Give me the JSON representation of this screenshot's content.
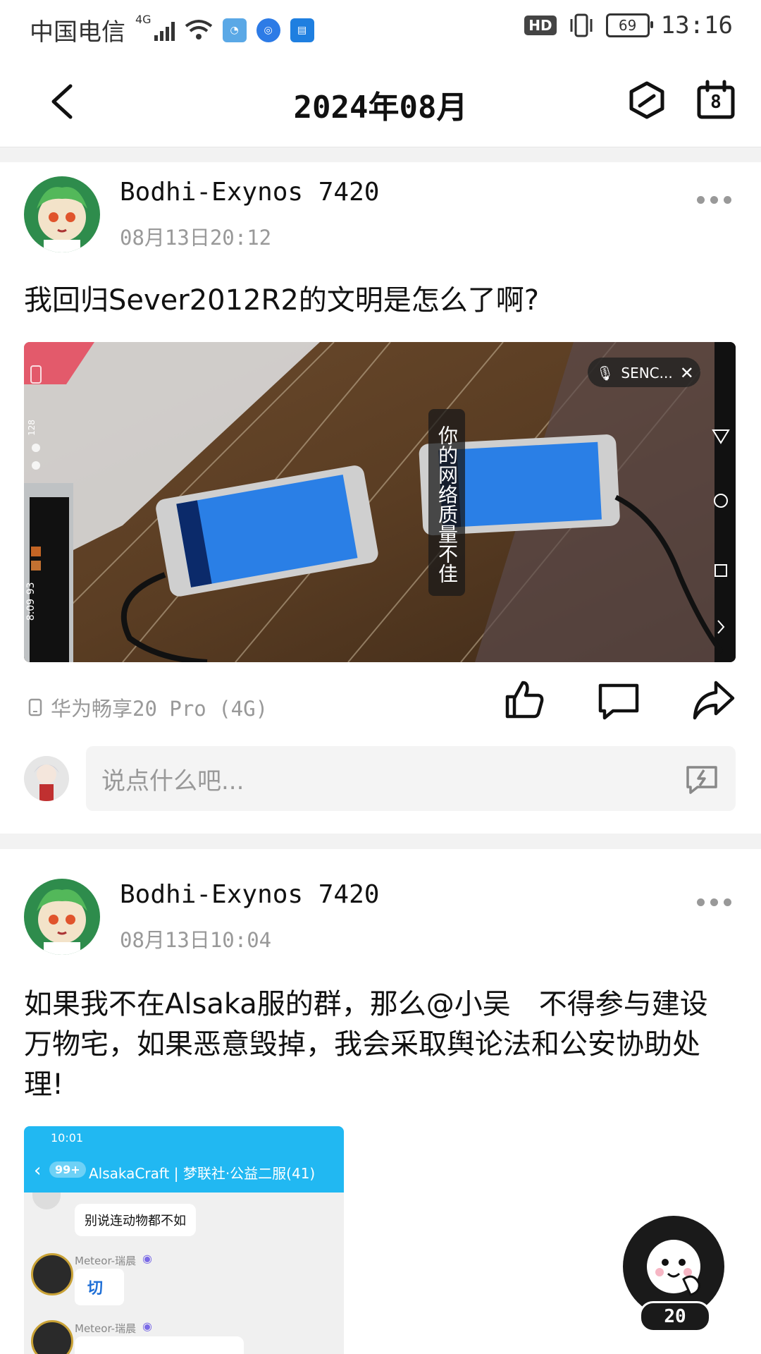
{
  "status_bar": {
    "carrier": "中国电信",
    "network": "4G",
    "hd": "HD",
    "battery": "69",
    "time": "13:16"
  },
  "header": {
    "title": "2024年08月",
    "calendar_day": "8",
    "icons": [
      "back-icon",
      "hexagon-slash-icon",
      "calendar-icon"
    ]
  },
  "posts": [
    {
      "username": "Bodhi-Exynos 7420",
      "time": "08月13日20:12",
      "text": "我回归Sever2012R2的文明是怎么了啊?",
      "media": {
        "screen_indicator": "SENC...",
        "overlay_text": "你的网络质量不佳",
        "edge_texts": [
          "8:09",
          "93",
          "128"
        ]
      },
      "device": "华为畅享20 Pro (4G)",
      "actions": [
        "like-icon",
        "comment-icon",
        "share-icon"
      ]
    },
    {
      "username": "Bodhi-Exynos 7420",
      "time": "08月13日10:04",
      "text": "如果我不在Alsaka服的群，那么@小吴　不得参与建设万物宅，如果恶意毁掉，我会采取舆论法和公安协助处理!",
      "media": {
        "phone_time": "10:01",
        "unread": "99+",
        "chat_title": "AlsakaCraft | 梦联社·公益二服(41)",
        "messages": [
          {
            "text": "别说连动物都不如"
          },
          {
            "sender": "Meteor-瑞晨",
            "text": "切"
          },
          {
            "sender": "Meteor-瑞晨",
            "text": ""
          }
        ]
      }
    }
  ],
  "comment_box": {
    "placeholder": "说点什么吧..."
  },
  "fab": {
    "count": "20"
  },
  "colors": {
    "accent_blue": "#1fb6f3",
    "text_gray": "#999999",
    "background": "#f2f2f2"
  }
}
